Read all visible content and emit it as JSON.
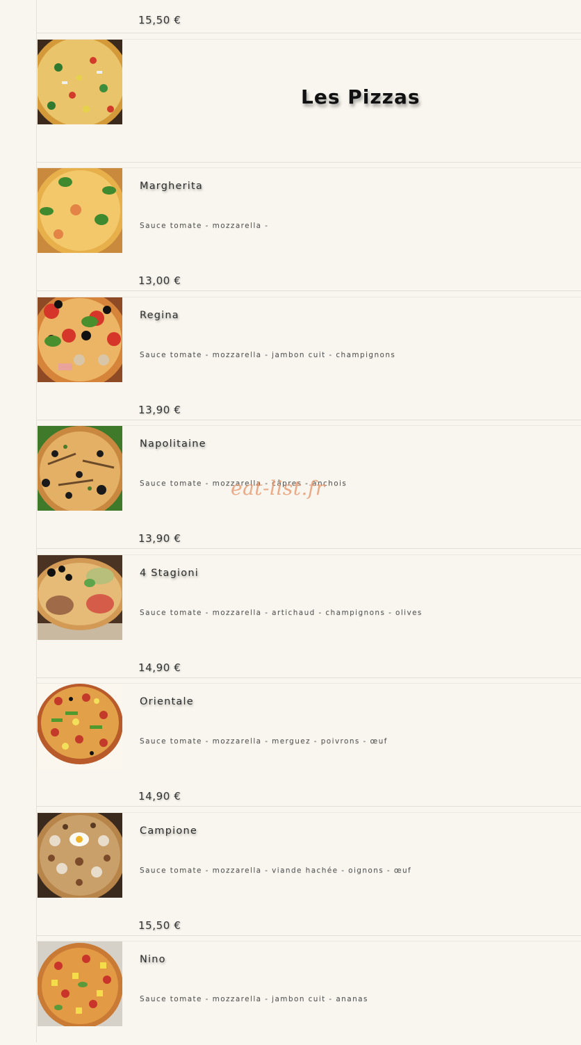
{
  "top_item": {
    "price": "15,50 €"
  },
  "section": {
    "title": "Les Pizzas"
  },
  "pizzas": [
    {
      "name": "Margherita",
      "desc": "Sauce tomate - mozzarella -",
      "price": "13,00 €"
    },
    {
      "name": "Regina",
      "desc": "Sauce tomate - mozzarella - jambon cuit - champignons",
      "price": "13,90 €"
    },
    {
      "name": "Napolitaine",
      "desc": "Sauce tomate - mozzarella - câpres - anchois",
      "price": "13,90 €"
    },
    {
      "name": "4 Stagioni",
      "desc": "Sauce tomate - mozzarella - artichaud - champignons - olives",
      "price": "14,90 €"
    },
    {
      "name": "Orientale",
      "desc": "Sauce tomate - mozzarella - merguez - poivrons - œuf",
      "price": "14,90 €"
    },
    {
      "name": "Campione",
      "desc": "Sauce tomate - mozzarella - viande hachée - oignons - œuf",
      "price": "15,50 €"
    },
    {
      "name": "Nino",
      "desc": "Sauce tomate - mozzarella - jambon cuit - ananas",
      "price": ""
    }
  ],
  "watermark": "eat-list.fr",
  "colors": {
    "background": "#f9f6ef",
    "watermark": "#e8956b",
    "text": "#2a2a2a"
  }
}
